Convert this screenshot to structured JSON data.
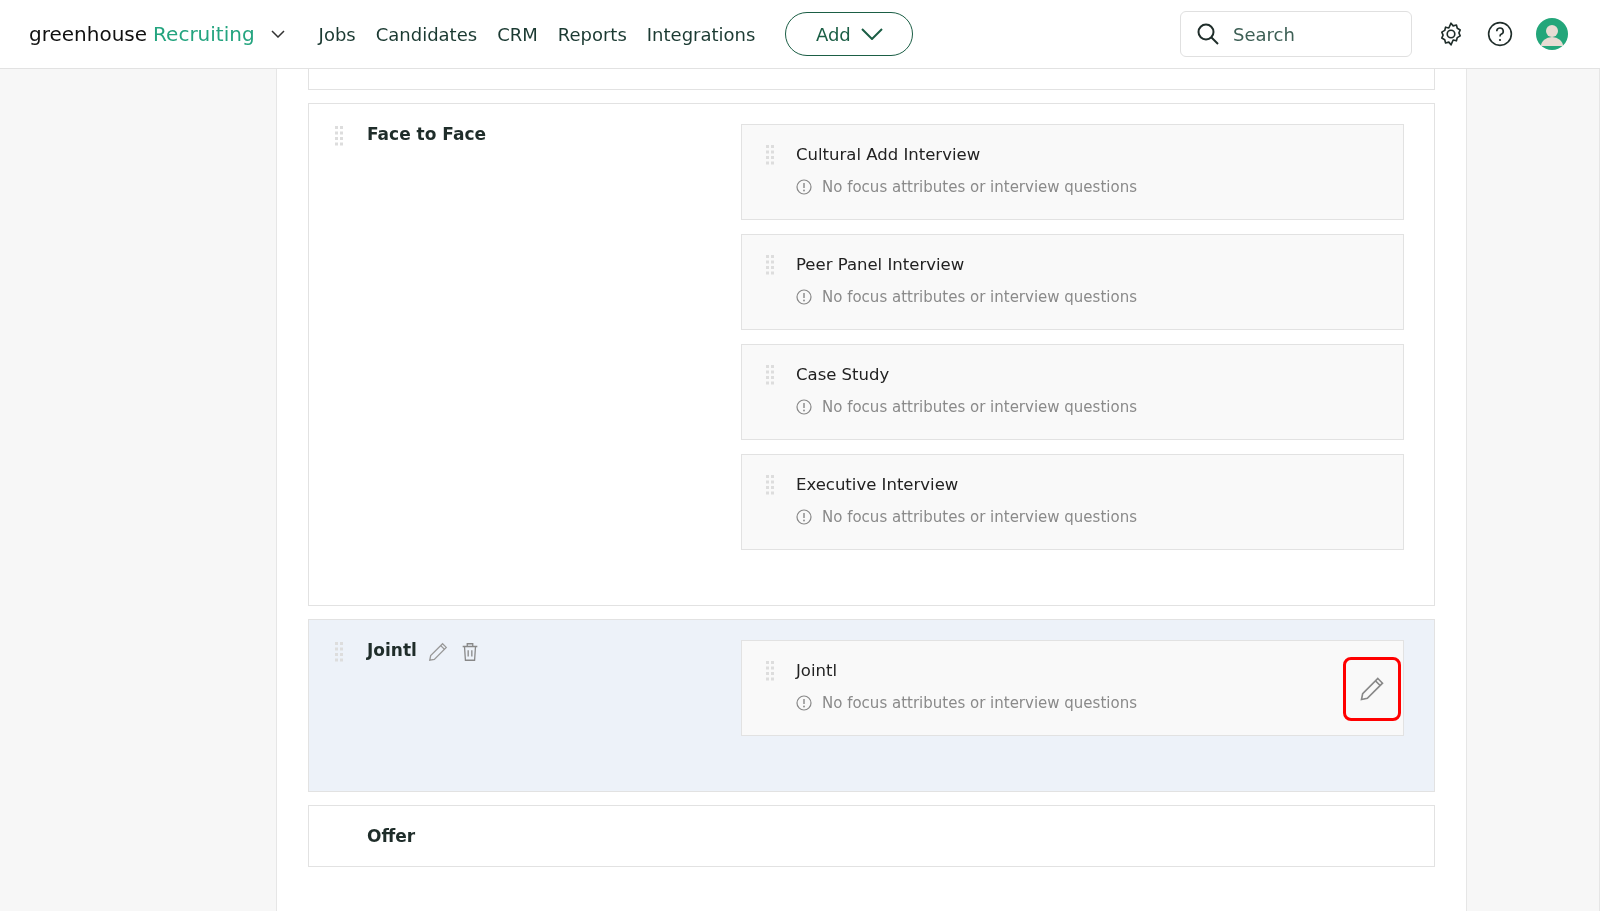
{
  "header": {
    "brand": "greenhouse",
    "product": "Recruiting",
    "nav": [
      "Jobs",
      "Candidates",
      "CRM",
      "Reports",
      "Integrations"
    ],
    "add_button": "Add",
    "search": {
      "placeholder": "Search"
    }
  },
  "stages": [
    {
      "name": "Face to Face",
      "selected": false,
      "interviews": [
        {
          "name": "Cultural Add Interview",
          "note": "No focus attributes or interview questions",
          "highlighted": false
        },
        {
          "name": "Peer Panel Interview",
          "note": "No focus attributes or interview questions",
          "highlighted": false
        },
        {
          "name": "Case Study",
          "note": "No focus attributes or interview questions",
          "highlighted": false
        },
        {
          "name": "Executive Interview",
          "note": "No focus attributes or interview questions",
          "highlighted": false
        }
      ]
    },
    {
      "name": "Jointl",
      "selected": true,
      "interviews": [
        {
          "name": "Jointl",
          "note": "No focus attributes or interview questions",
          "highlighted": true
        }
      ]
    },
    {
      "name": "Offer",
      "selected": false
    }
  ]
}
